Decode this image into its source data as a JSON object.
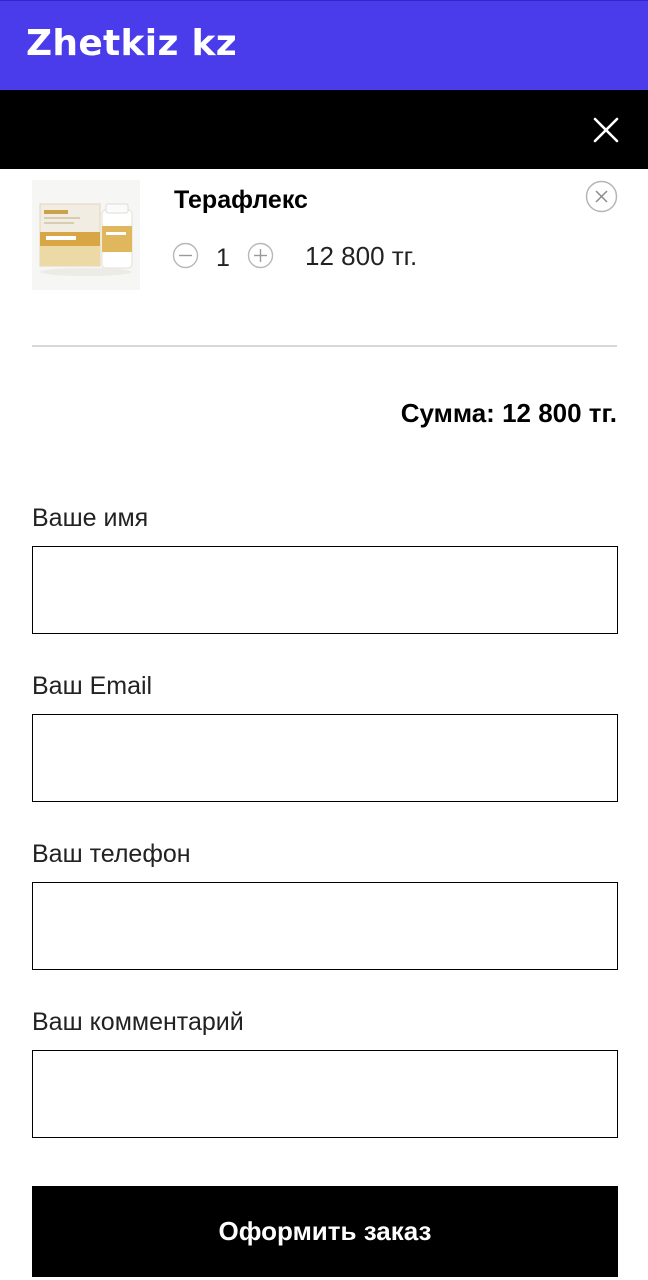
{
  "header": {
    "brand": "Zhetkiz kz",
    "accent_color": "#4a3cea",
    "close_icon": "close-icon"
  },
  "cart": {
    "items": [
      {
        "name": "Терафлекс",
        "quantity": "1",
        "price": "12 800 тг.",
        "image_icon": "product-image",
        "remove_icon": "remove-circle-icon",
        "minus_icon": "minus-circle-icon",
        "plus_icon": "plus-circle-icon"
      }
    ],
    "total": "Сумма: 12 800 тг."
  },
  "form": {
    "fields": [
      {
        "label": "Ваше имя",
        "value": ""
      },
      {
        "label": "Ваш Email",
        "value": ""
      },
      {
        "label": "Ваш телефон",
        "value": ""
      },
      {
        "label": "Ваш комментарий",
        "value": ""
      }
    ],
    "submit_label": "Оформить заказ"
  }
}
